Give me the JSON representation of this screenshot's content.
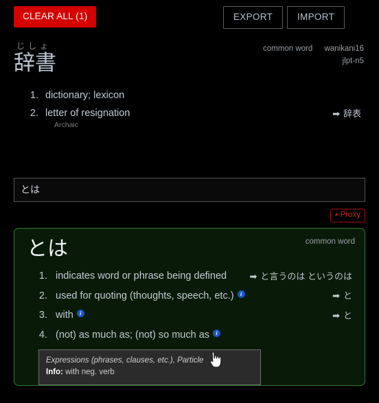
{
  "toolbar": {
    "clear_all_label": "CLEAR ALL (1)",
    "export_label": "EXPORT",
    "import_label": "IMPORT",
    "clear_all_color": "#d40000"
  },
  "entry": {
    "furigana": "じしょ",
    "headword": "辞書",
    "tags_row1": [
      "common word",
      "wanikani16"
    ],
    "tags_row2": [
      "jlpt-n5"
    ],
    "senses": [
      {
        "num": "1.",
        "text": "dictionary; lexicon",
        "note": "",
        "xref_arrow": "➡",
        "xref": ""
      },
      {
        "num": "2.",
        "text": "letter of resignation",
        "note": "Archaic",
        "xref_arrow": "➡",
        "xref": "辞表"
      }
    ]
  },
  "search": {
    "value": "とは",
    "placeholder": ""
  },
  "proxy": {
    "triangle": "▲",
    "label": "Proxy",
    "color": "#d22020"
  },
  "card": {
    "headword": "とは",
    "tag": "common word",
    "border_color": "#2f7a2f",
    "background_color": "#0a1a08",
    "senses": [
      {
        "num": "1.",
        "text": "indicates word or phrase being defined",
        "info": "",
        "xref_arrow": "➡",
        "xref": "と言うのは というのは"
      },
      {
        "num": "2.",
        "text": "used for quoting (thoughts, speech, etc.)",
        "info": "i",
        "xref_arrow": "➡",
        "xref": "と"
      },
      {
        "num": "3.",
        "text": "with",
        "info": "i",
        "xref_arrow": "➡",
        "xref": "と"
      },
      {
        "num": "4.",
        "text": "(not) as much as; (not) so much as",
        "info": "i",
        "xref_arrow": "",
        "xref": ""
      },
      {
        "num": "5.",
        "text": "",
        "info": "",
        "xref_arrow": "",
        "xref": ""
      }
    ]
  },
  "tooltip": {
    "parts_of_speech": "Expressions (phrases, clauses, etc.), Particle",
    "info_label": "Info:",
    "info_value": "with neg. verb"
  }
}
